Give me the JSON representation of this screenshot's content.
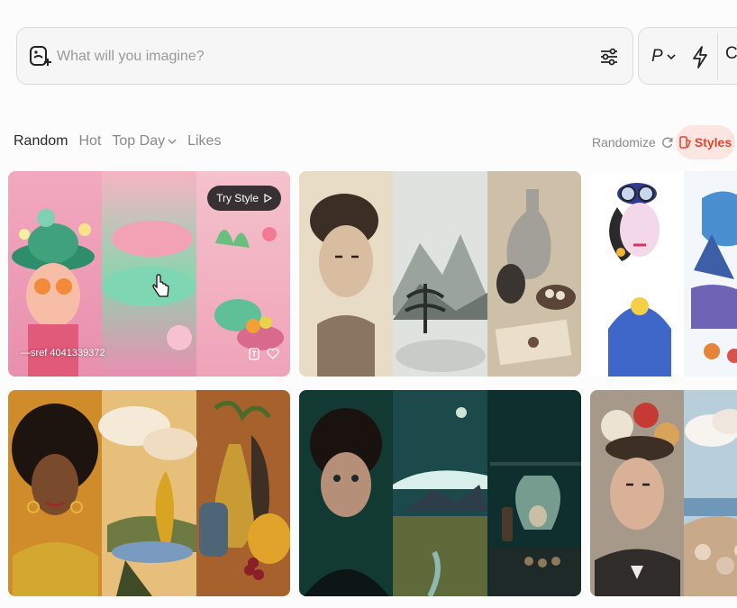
{
  "prompt": {
    "placeholder": "What will you imagine?"
  },
  "controls": {
    "mode_letter": "P",
    "extra_letter": "C"
  },
  "tabs": [
    {
      "label": "Random",
      "active": true
    },
    {
      "label": "Hot",
      "active": false
    },
    {
      "label": "Top Day",
      "active": false
    },
    {
      "label": "Likes",
      "active": false
    }
  ],
  "randomize_label": "Randomize",
  "styles_label": "Styles",
  "cards": [
    {
      "try_style_label": "Try Style",
      "sref_label": "—sref 4041339372"
    }
  ],
  "colors": {
    "accent": "#e2462b",
    "accent_bg": "#fde6e2"
  },
  "icons": [
    "image-add-icon",
    "sliders-icon",
    "chevron-down-icon",
    "bolt-icon",
    "refresh-icon",
    "styles-icon",
    "play-icon",
    "bookmark-icon",
    "heart-icon"
  ]
}
